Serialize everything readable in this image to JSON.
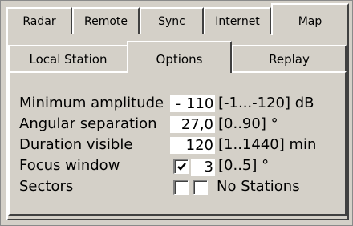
{
  "top_tabs": [
    {
      "label": "Radar"
    },
    {
      "label": "Remote"
    },
    {
      "label": "Sync"
    },
    {
      "label": "Internet"
    },
    {
      "label": "Map"
    }
  ],
  "sub_tabs": [
    {
      "label": "Local Station"
    },
    {
      "label": "Options"
    },
    {
      "label": "Replay"
    }
  ],
  "active_top_tab": "Map",
  "active_sub_tab": "Options",
  "form": {
    "min_amplitude": {
      "label": "Minimum amplitude",
      "sign": "-",
      "value": "110",
      "range": "[-1...-120] dB"
    },
    "angular_separation": {
      "label": "Angular separation",
      "value": "27,0",
      "range": "[0..90] °"
    },
    "duration_visible": {
      "label": "Duration visible",
      "value": "120",
      "range": "[1..1440] min"
    },
    "focus_window": {
      "label": "Focus window",
      "checked": true,
      "value": "3",
      "range": "[0..5] °"
    },
    "sectors": {
      "label": "Sectors",
      "check1": false,
      "check2": false,
      "status": "No Stations"
    }
  }
}
